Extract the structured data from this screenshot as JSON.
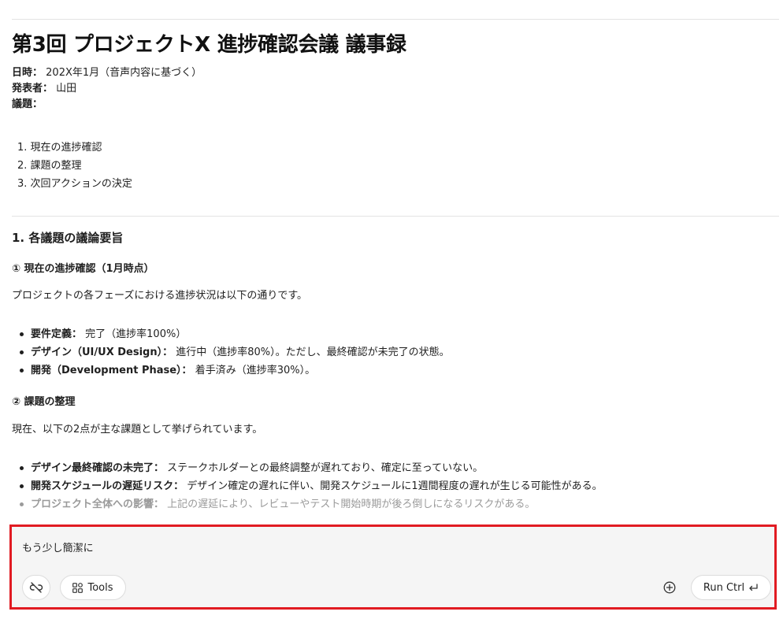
{
  "document": {
    "title": "第3回 プロジェクトX 進捗確認会議 議事録",
    "meta": {
      "date_label": "日時：",
      "date_value": "202X年1月（音声内容に基づく）",
      "presenter_label": "発表者：",
      "presenter_value": "山田",
      "agenda_label": "議題："
    },
    "agenda": [
      "1. 現在の進捗確認",
      "2. 課題の整理",
      "3. 次回アクションの決定"
    ],
    "section1": {
      "heading": "1. 各議題の議論要旨",
      "sub1": {
        "heading": "① 現在の進捗確認（1月時点）",
        "intro": "プロジェクトの各フェーズにおける進捗状況は以下の通りです。",
        "items": [
          {
            "label": "要件定義：",
            "text": " 完了（進捗率100%）"
          },
          {
            "label": "デザイン（UI/UX Design）：",
            "text": " 進行中（進捗率80%）。ただし、最終確認が未完了の状態。"
          },
          {
            "label": "開発（Development Phase）：",
            "text": " 着手済み（進捗率30%）。"
          }
        ]
      },
      "sub2": {
        "heading": "② 課題の整理",
        "intro": "現在、以下の2点が主な課題として挙げられています。",
        "items": [
          {
            "label": "デザイン最終確認の未完了：",
            "text": " ステークホルダーとの最終調整が遅れており、確定に至っていない。"
          },
          {
            "label": "開発スケジュールの遅延リスク：",
            "text": " デザイン確定の遅れに伴い、開発スケジュールに1週間程度の遅れが生じる可能性がある。"
          },
          {
            "label": "プロジェクト全体への影響：",
            "text": " 上記の遅延により、レビューやテスト開始時期が後ろ倒しになるリスクがある。"
          }
        ]
      }
    }
  },
  "composer": {
    "input_text": "もう少し簡潔に",
    "tools_label": "Tools",
    "run_label": "Run Ctrl",
    "accent_border": "#e11b22",
    "icons": {
      "link": "link-off-icon",
      "tools": "grid-icon",
      "add": "plus-circle-icon",
      "run": "enter-icon"
    }
  }
}
